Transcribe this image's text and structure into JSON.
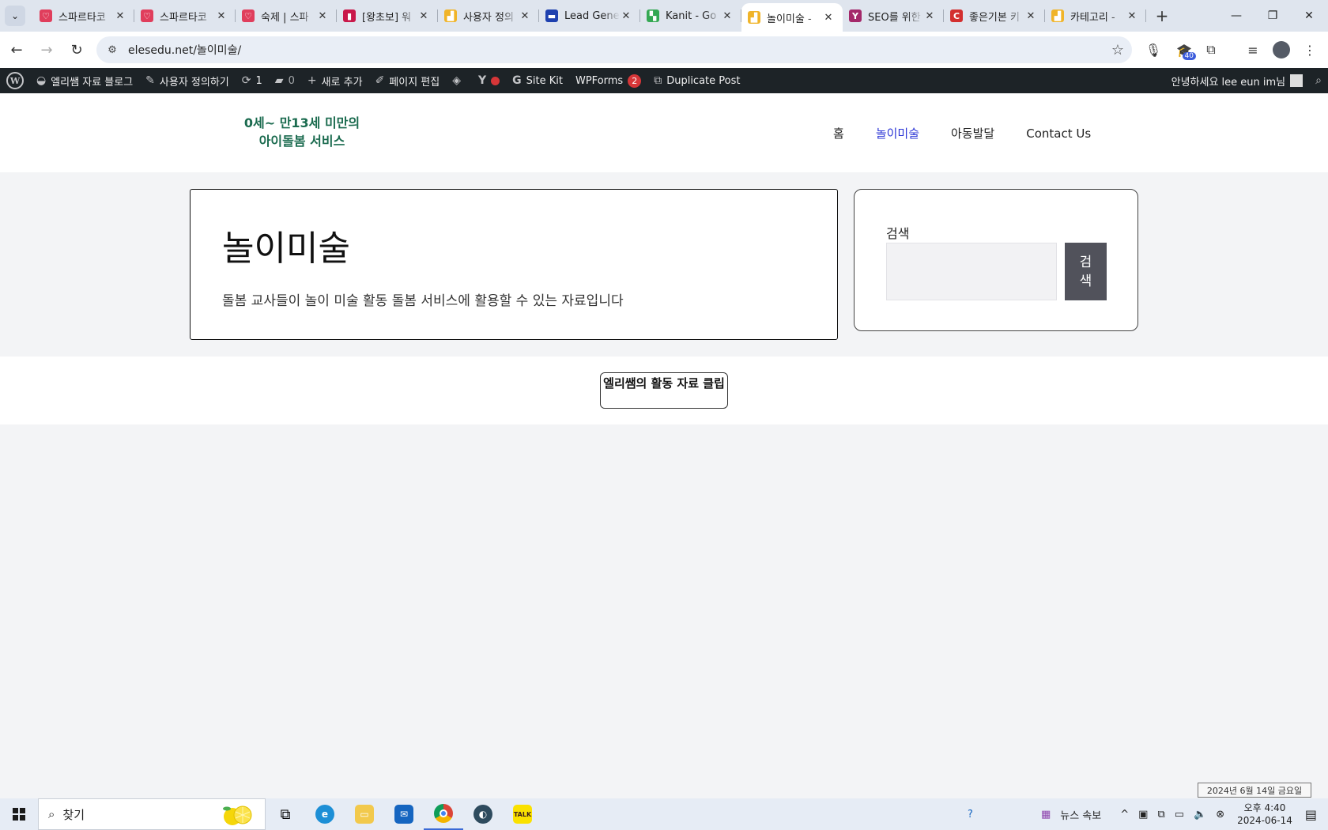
{
  "browser": {
    "tabs": [
      {
        "title": "스파르타코",
        "favicon_color": "#e03e5c",
        "favicon_glyph": "♡"
      },
      {
        "title": "스파르타코",
        "favicon_color": "#e03e5c",
        "favicon_glyph": "♡"
      },
      {
        "title": "숙제 | 스파",
        "favicon_color": "#e03e5c",
        "favicon_glyph": "♡"
      },
      {
        "title": "[왕초보] 워",
        "favicon_color": "#c9184a",
        "favicon_glyph": "▮"
      },
      {
        "title": "사용자 정의",
        "favicon_color": "#f0b429",
        "favicon_glyph": "▟"
      },
      {
        "title": "Lead Gene",
        "favicon_color": "#1e40af",
        "favicon_glyph": "▬"
      },
      {
        "title": "Kanit - Go",
        "favicon_color": "#34a853",
        "favicon_glyph": "▚"
      },
      {
        "title": "놀이미술 -",
        "favicon_color": "#f0b429",
        "favicon_glyph": "▟"
      },
      {
        "title": "SEO를 위한",
        "favicon_color": "#a4286a",
        "favicon_glyph": "Y"
      },
      {
        "title": "좋은기본 키",
        "favicon_color": "#d32f2f",
        "favicon_glyph": "C"
      },
      {
        "title": "카테고리 -",
        "favicon_color": "#f0b429",
        "favicon_glyph": "▟"
      }
    ],
    "active_tab_index": 7,
    "url": "elesedu.net/놀이미술/",
    "extension_badge": "40"
  },
  "wp_admin_bar": {
    "site_name": "엘리쌤 자료 블로그",
    "customize": "사용자 정의하기",
    "updates_count": "1",
    "comments_count": "0",
    "new": "새로 추가",
    "edit_page": "페이지 편집",
    "site_kit": "Site Kit",
    "wpforms": "WPForms",
    "wpforms_count": "2",
    "duplicate_post": "Duplicate Post",
    "greeting": "안녕하세요 lee eun im님"
  },
  "site": {
    "logo_line1": "0세~ 만13세 미만의",
    "logo_line2": "아이돌봄 서비스",
    "nav": [
      "홈",
      "놀이미술",
      "아동발달",
      "Contact Us"
    ],
    "current_nav_index": 1,
    "page_title": "놀이미술",
    "page_description": "돌봄 교사들이 놀이 미술 활동 돌봄 서비스에 활용할 수 있는 자료입니다",
    "search_label": "검색",
    "search_placeholder": "",
    "search_button": "검색",
    "cta_button": "엘리쌤의 활동 자료 클립"
  },
  "taskbar": {
    "search_text": "찾기",
    "news": "뉴스 속보",
    "time": "오후 4:40",
    "date": "2024-06-14",
    "date_tooltip": "2024년 6월 14일 금요일"
  },
  "colors": {
    "nav_active": "#2b35d6",
    "wp_bar_bg": "#1d2327",
    "logo_green": "#1b6b4f",
    "search_button_bg": "#51525b"
  }
}
